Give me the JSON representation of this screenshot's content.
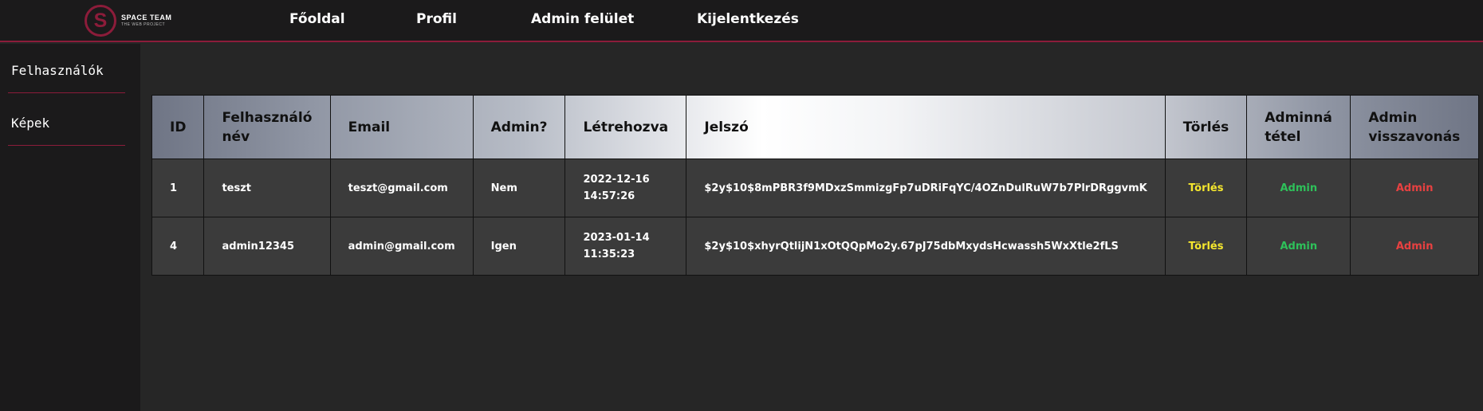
{
  "logo": {
    "letter": "S",
    "title": "SPACE TEAM",
    "subtitle": "THE WEB PROJECT"
  },
  "nav": {
    "home": "Főoldal",
    "profile": "Profil",
    "admin": "Admin felület",
    "logout": "Kijelentkezés"
  },
  "sidebar": {
    "items": [
      {
        "label": "Felhasználók"
      },
      {
        "label": "Képek"
      }
    ]
  },
  "table": {
    "headers": {
      "id": "ID",
      "username": "Felhasználó név",
      "email": "Email",
      "admin": "Admin?",
      "created": "Létrehozva",
      "password": "Jelszó",
      "delete": "Törlés",
      "make_admin": "Adminná tétel",
      "revoke_admin": "Admin visszavonás"
    },
    "rows": [
      {
        "id": "1",
        "username": "teszt",
        "email": "teszt@gmail.com",
        "admin": "Nem",
        "created_date": "2022-12-16",
        "created_time": "14:57:26",
        "password": "$2y$10$8mPBR3f9MDxzSmmizgFp7uDRiFqYC/4OZnDulRuW7b7PlrDRggvmK",
        "delete": "Törlés",
        "make_admin": "Admin",
        "revoke_admin": "Admin"
      },
      {
        "id": "4",
        "username": "admin12345",
        "email": "admin@gmail.com",
        "admin": "Igen",
        "created_date": "2023-01-14",
        "created_time": "11:35:23",
        "password": "$2y$10$xhyrQtlijN1xOtQQpMo2y.67pJ75dbMxydsHcwassh5WxXtle2fLS",
        "delete": "Törlés",
        "make_admin": "Admin",
        "revoke_admin": "Admin"
      }
    ]
  },
  "colors": {
    "accent": "#8c1c3a",
    "delete": "#f5e72e",
    "make_admin": "#2ec15a",
    "revoke_admin": "#e84141"
  }
}
